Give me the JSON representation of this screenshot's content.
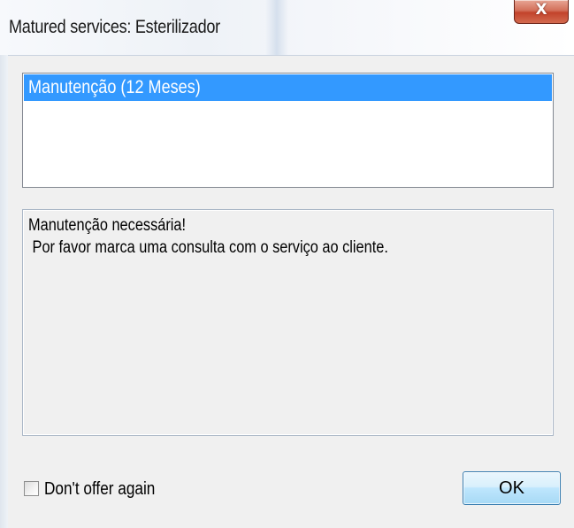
{
  "window": {
    "title": "Matured services: Esterilizador",
    "close_glyph": "X"
  },
  "service_list": {
    "items": [
      {
        "label": "Manutenção (12 Meses)",
        "selected": true
      }
    ]
  },
  "message": {
    "line1": "Manutenção necessária!",
    "line2": " Por favor marca uma consulta com o serviço ao cliente."
  },
  "options": {
    "dont_offer_again_label": "Don't offer again",
    "dont_offer_again_checked": false
  },
  "buttons": {
    "ok_label": "OK"
  },
  "colors": {
    "selection": "#3399ff",
    "dialog_background": "#f0f0f0",
    "close_button": "#c2432b"
  },
  "icons": {
    "close": "close-icon"
  }
}
